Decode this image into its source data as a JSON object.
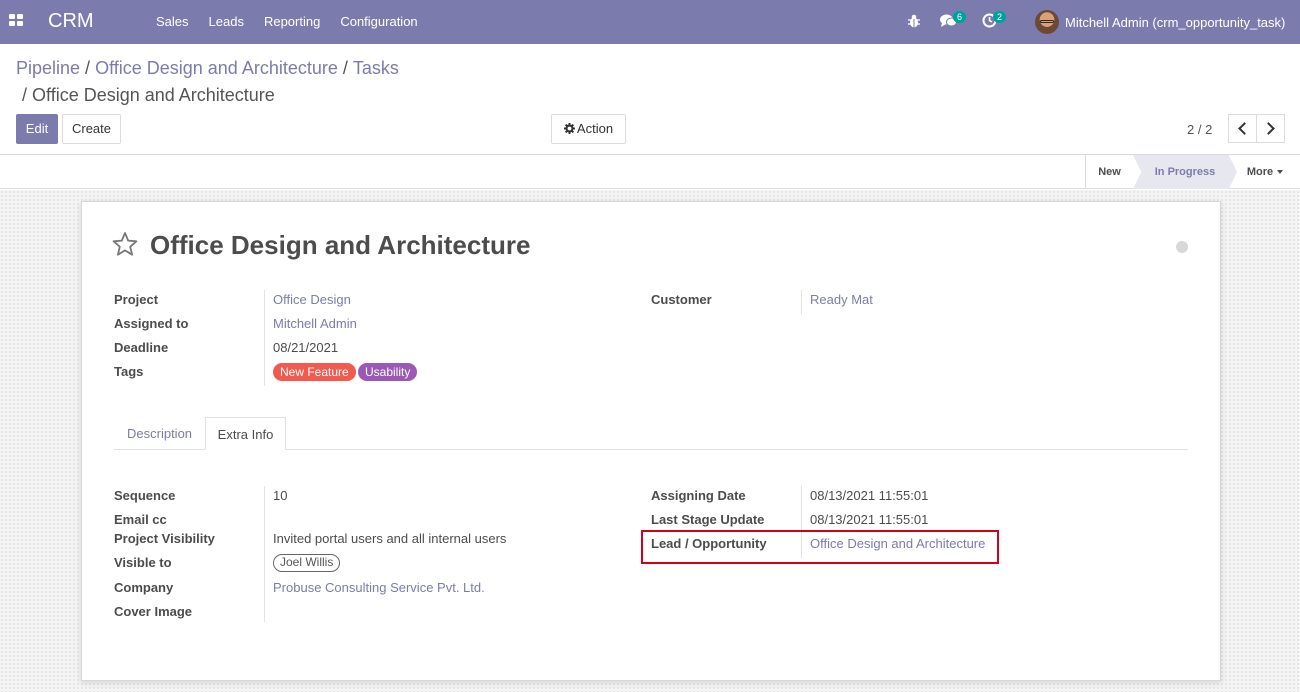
{
  "navbar": {
    "app_name": "CRM",
    "menu": [
      "Sales",
      "Leads",
      "Reporting",
      "Configuration"
    ],
    "messages_count": "6",
    "activities_count": "2",
    "user_name": "Mitchell Admin (crm_opportunity_task)"
  },
  "breadcrumb": {
    "items": [
      "Pipeline",
      "Office Design and Architecture",
      "Tasks"
    ],
    "current": "Office Design and Architecture",
    "separator": "/"
  },
  "toolbar": {
    "edit_label": "Edit",
    "create_label": "Create",
    "action_label": "Action",
    "pager": "2 / 2"
  },
  "statusbar": {
    "stages": [
      "New",
      "In Progress"
    ],
    "active_stage": "In Progress",
    "more_label": "More"
  },
  "record": {
    "title": "Office Design and Architecture",
    "project_label": "Project",
    "project": "Office Design",
    "assigned_label": "Assigned to",
    "assigned": "Mitchell Admin",
    "deadline_label": "Deadline",
    "deadline": "08/21/2021",
    "tags_label": "Tags",
    "tags": [
      "New Feature",
      "Usability"
    ],
    "customer_label": "Customer",
    "customer": "Ready Mat"
  },
  "tabs": [
    "Description",
    "Extra Info"
  ],
  "extra_info": {
    "sequence_label": "Sequence",
    "sequence": "10",
    "email_cc_label": "Email cc",
    "visibility_label": "Project Visibility",
    "visibility": "Invited portal users and all internal users",
    "visible_to_label": "Visible to",
    "visible_to": "Joel Willis",
    "company_label": "Company",
    "company": "Probuse Consulting Service Pvt. Ltd.",
    "cover_label": "Cover Image",
    "assign_date_label": "Assigning Date",
    "assign_date": "08/13/2021 11:55:01",
    "last_stage_label": "Last Stage Update",
    "last_stage": "08/13/2021 11:55:01",
    "lead_label": "Lead / Opportunity",
    "lead": "Office Design and Architecture"
  },
  "colors": {
    "brand": "#7c7bad",
    "tag_red": "#f05a4f",
    "tag_purple": "#9b59b6",
    "badge": "#00a09d",
    "highlight": "#d0021b"
  }
}
